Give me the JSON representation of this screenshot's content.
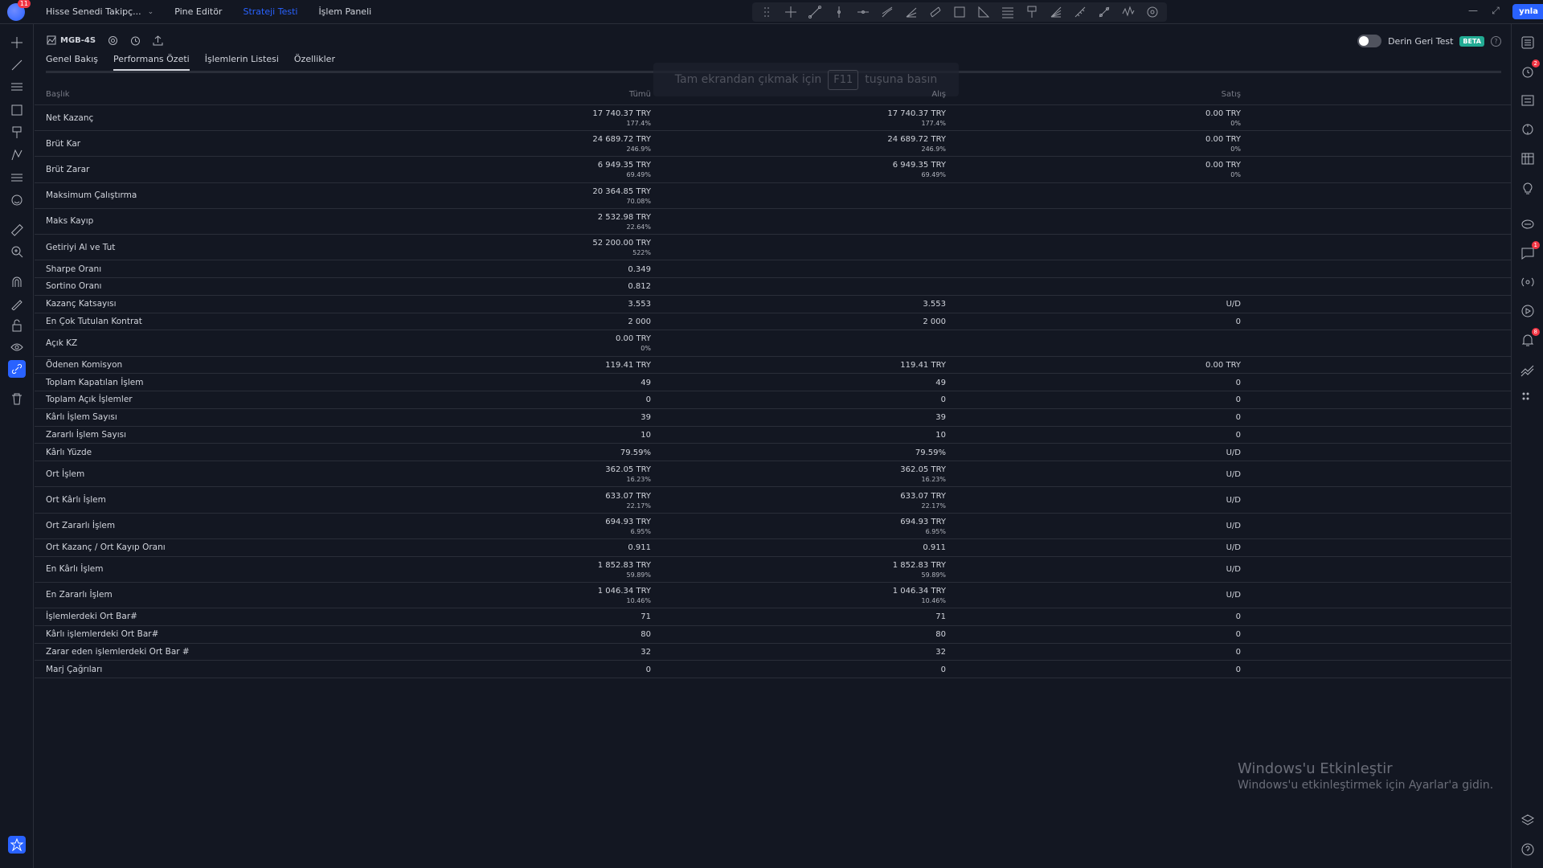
{
  "topbar": {
    "menu": [
      {
        "label": "Hisse Senedi Takipç...",
        "has_chevron": true
      },
      {
        "label": "Pine Editör"
      },
      {
        "label": "Strateji Testi",
        "active": true
      },
      {
        "label": "İşlem Paneli"
      }
    ],
    "logo_badge": "11",
    "login_label": "ynla"
  },
  "strategy": {
    "name": "MGB-4S",
    "deep_test_label": "Derin Geri Test",
    "beta_label": "BETA"
  },
  "tabs": [
    {
      "label": "Genel Bakış"
    },
    {
      "label": "Performans Özeti",
      "active": true
    },
    {
      "label": "İşlemlerin Listesi"
    },
    {
      "label": "Özellikler"
    }
  ],
  "fullscreen_hint": {
    "before": "Tam ekrandan çıkmak için",
    "key": "F11",
    "after": "tuşuna basın"
  },
  "table": {
    "headers": {
      "title": "Başlık",
      "all": "Tümü",
      "long": "Alış",
      "short": "Satış"
    },
    "rows": [
      {
        "title": "Net Kazanç",
        "all": [
          "17 740.37 TRY",
          "177.4%"
        ],
        "long": [
          "17 740.37 TRY",
          "177.4%"
        ],
        "short": [
          "0.00 TRY",
          "0%"
        ]
      },
      {
        "title": "Brüt Kar",
        "all": [
          "24 689.72 TRY",
          "246.9%"
        ],
        "long": [
          "24 689.72 TRY",
          "246.9%"
        ],
        "short": [
          "0.00 TRY",
          "0%"
        ]
      },
      {
        "title": "Brüt Zarar",
        "all": [
          "6 949.35 TRY",
          "69.49%"
        ],
        "long": [
          "6 949.35 TRY",
          "69.49%"
        ],
        "short": [
          "0.00 TRY",
          "0%"
        ]
      },
      {
        "title": "Maksimum Çalıştırma",
        "all": [
          "20 364.85 TRY",
          "70.08%"
        ],
        "long": [],
        "short": []
      },
      {
        "title": "Maks Kayıp",
        "all": [
          "2 532.98 TRY",
          "22.64%"
        ],
        "long": [],
        "short": []
      },
      {
        "title": "Getiriyi Al ve Tut",
        "all": [
          "52 200.00 TRY",
          "522%"
        ],
        "long": [],
        "short": []
      },
      {
        "title": "Sharpe Oranı",
        "all": [
          "0.349"
        ],
        "long": [],
        "short": []
      },
      {
        "title": "Sortino Oranı",
        "all": [
          "0.812"
        ],
        "long": [],
        "short": []
      },
      {
        "title": "Kazanç Katsayısı",
        "all": [
          "3.553"
        ],
        "long": [
          "3.553"
        ],
        "short": [
          "U/D"
        ]
      },
      {
        "title": "En Çok Tutulan Kontrat",
        "all": [
          "2 000"
        ],
        "long": [
          "2 000"
        ],
        "short": [
          "0"
        ]
      },
      {
        "title": "Açık KZ",
        "all": [
          "0.00 TRY",
          "0%"
        ],
        "long": [],
        "short": []
      },
      {
        "title": "Ödenen Komisyon",
        "all": [
          "119.41 TRY"
        ],
        "long": [
          "119.41 TRY"
        ],
        "short": [
          "0.00 TRY"
        ]
      },
      {
        "title": "Toplam Kapatılan İşlem",
        "all": [
          "49"
        ],
        "long": [
          "49"
        ],
        "short": [
          "0"
        ]
      },
      {
        "title": "Toplam Açık İşlemler",
        "all": [
          "0"
        ],
        "long": [
          "0"
        ],
        "short": [
          "0"
        ]
      },
      {
        "title": "Kârlı İşlem Sayısı",
        "all": [
          "39"
        ],
        "long": [
          "39"
        ],
        "short": [
          "0"
        ]
      },
      {
        "title": "Zararlı İşlem Sayısı",
        "all": [
          "10"
        ],
        "long": [
          "10"
        ],
        "short": [
          "0"
        ]
      },
      {
        "title": "Kârlı Yüzde",
        "all": [
          "79.59%"
        ],
        "long": [
          "79.59%"
        ],
        "short": [
          "U/D"
        ]
      },
      {
        "title": "Ort İşlem",
        "all": [
          "362.05 TRY",
          "16.23%"
        ],
        "long": [
          "362.05 TRY",
          "16.23%"
        ],
        "short": [
          "U/D"
        ]
      },
      {
        "title": "Ort Kârlı İşlem",
        "all": [
          "633.07 TRY",
          "22.17%"
        ],
        "long": [
          "633.07 TRY",
          "22.17%"
        ],
        "short": [
          "U/D"
        ]
      },
      {
        "title": "Ort Zararlı İşlem",
        "all": [
          "694.93 TRY",
          "6.95%"
        ],
        "long": [
          "694.93 TRY",
          "6.95%"
        ],
        "short": [
          "U/D"
        ]
      },
      {
        "title": "Ort Kazanç / Ort Kayıp Oranı",
        "all": [
          "0.911"
        ],
        "long": [
          "0.911"
        ],
        "short": [
          "U/D"
        ]
      },
      {
        "title": "En Kârlı İşlem",
        "all": [
          "1 852.83 TRY",
          "59.89%"
        ],
        "long": [
          "1 852.83 TRY",
          "59.89%"
        ],
        "short": [
          "U/D"
        ]
      },
      {
        "title": "En Zararlı İşlem",
        "all": [
          "1 046.34 TRY",
          "10.46%"
        ],
        "long": [
          "1 046.34 TRY",
          "10.46%"
        ],
        "short": [
          "U/D"
        ]
      },
      {
        "title": "İşlemlerdeki Ort Bar#",
        "all": [
          "71"
        ],
        "long": [
          "71"
        ],
        "short": [
          "0"
        ]
      },
      {
        "title": "Kârlı işlemlerdeki Ort Bar#",
        "all": [
          "80"
        ],
        "long": [
          "80"
        ],
        "short": [
          "0"
        ]
      },
      {
        "title": "Zarar eden işlemlerdeki Ort Bar #",
        "all": [
          "32"
        ],
        "long": [
          "32"
        ],
        "short": [
          "0"
        ]
      },
      {
        "title": "Marj Çağrıları",
        "all": [
          "0"
        ],
        "long": [
          "0"
        ],
        "short": [
          "0"
        ]
      }
    ]
  },
  "watermark": {
    "line1": "Windows'u Etkinleştir",
    "line2": "Windows'u etkinleştirmek için Ayarlar'a gidin."
  },
  "right_badges": {
    "alerts": "2",
    "chat": "1",
    "notifications": "8"
  },
  "colors": {
    "background": "#131722",
    "accent": "#2962ff",
    "border": "#2a2e39",
    "text": "#d1d4dc",
    "muted": "#787b86",
    "beta": "#22ab94",
    "badge": "#f23645"
  }
}
